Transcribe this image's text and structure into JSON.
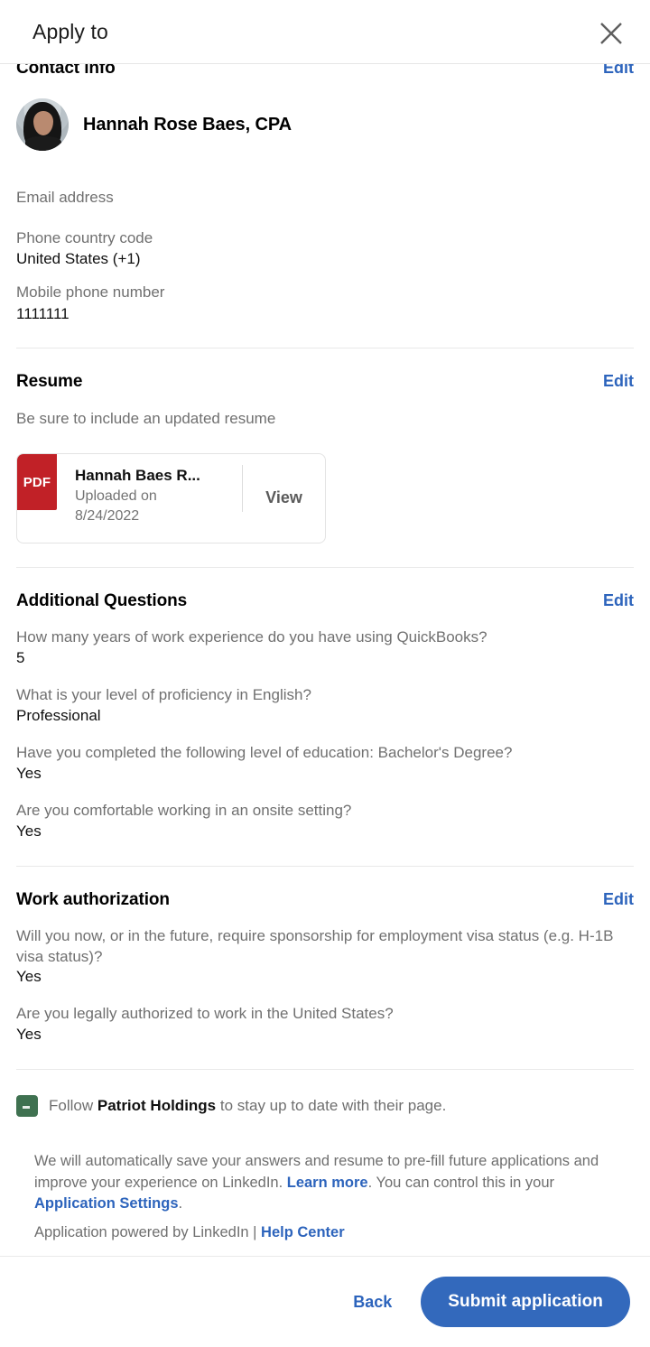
{
  "header": {
    "title": "Apply to",
    "close_icon": "close-icon"
  },
  "contact": {
    "section_title": "Contact info",
    "edit_label": "Edit",
    "person_name": "Hannah Rose Baes, CPA",
    "fields": [
      {
        "label": "Email address",
        "value": ""
      },
      {
        "label": "Phone country code",
        "value": "United States (+1)"
      },
      {
        "label": "Mobile phone number",
        "value": "1111111"
      }
    ]
  },
  "resume": {
    "section_title": "Resume",
    "edit_label": "Edit",
    "subtitle": "Be sure to include an updated resume",
    "file_type": "PDF",
    "file_name": "Hannah Baes R...",
    "uploaded_label": "Uploaded on",
    "uploaded_date": "8/24/2022",
    "view_label": "View"
  },
  "additional_questions": {
    "section_title": "Additional Questions",
    "edit_label": "Edit",
    "items": [
      {
        "question": "How many years of work experience do you have using QuickBooks?",
        "answer": "5"
      },
      {
        "question": "What is your level of proficiency in English?",
        "answer": "Professional"
      },
      {
        "question": "Have you completed the following level of education: Bachelor's Degree?",
        "answer": "Yes"
      },
      {
        "question": "Are you comfortable working in an onsite setting?",
        "answer": "Yes"
      }
    ]
  },
  "work_authorization": {
    "section_title": "Work authorization",
    "edit_label": "Edit",
    "items": [
      {
        "question": "Will you now, or in the future, require sponsorship for employment visa status (e.g. H-1B visa status)?",
        "answer": "Yes"
      },
      {
        "question": "Are you legally authorized to work in the United States?",
        "answer": "Yes"
      }
    ]
  },
  "follow": {
    "checked": true,
    "prefix": "Follow ",
    "company": "Patriot Holdings",
    "suffix": " to stay up to date with their page."
  },
  "disclaimer": {
    "part1": "We will automatically save your answers and resume to pre-fill future applications and improve your experience on LinkedIn. ",
    "link1": "Learn more",
    "part2": ". You can control this in your ",
    "link2": "Application Settings",
    "part3": ".",
    "powered_prefix": "Application powered by LinkedIn | ",
    "help_link": "Help Center"
  },
  "footer": {
    "back_label": "Back",
    "submit_label": "Submit application"
  },
  "colors": {
    "link_blue": "#2d64bc",
    "button_blue": "#3369bc",
    "pdf_red": "#c12127",
    "checkbox_green": "#3f7150"
  }
}
